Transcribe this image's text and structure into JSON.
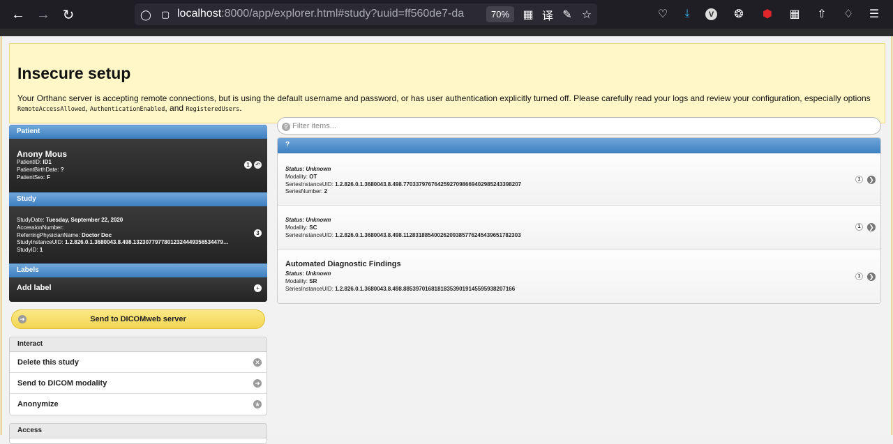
{
  "browser": {
    "url_host": "localhost",
    "url_rest": ":8000/app/explorer.html#study?uuid=ff560de7-da",
    "zoom": "70%"
  },
  "warning": {
    "title": "Insecure setup",
    "text": "Your Orthanc server is accepting remote connections, but is using the default username and password, or has user authentication explicitly turned off. Please carefully read your logs and review your configuration, especially options",
    "opt1": "RemoteAccessAllowed",
    "opt2": "AuthenticationEnabled",
    "and": ", and",
    "opt3": "RegisteredUsers"
  },
  "patient": {
    "header": "Patient",
    "name": "Anony Mous",
    "id_label": "PatientID:",
    "id": "ID1",
    "birth_label": "PatientBirthDate:",
    "birth": "?",
    "sex_label": "PatientSex:",
    "sex": "F",
    "count": "1"
  },
  "study": {
    "header": "Study",
    "date_label": "StudyDate:",
    "date": "Tuesday, September 22, 2020",
    "accession_label": "AccessionNumber:",
    "physician_label": "ReferringPhysicianName:",
    "physician": "Doctor Doc",
    "uid_label": "StudyInstanceUID:",
    "uid": "1.2.826.0.1.3680043.8.498.13230779778012324449356534479…",
    "id_label": "StudyID:",
    "id": "1",
    "count": "3"
  },
  "labels": {
    "header": "Labels",
    "add": "Add label"
  },
  "send_dicomweb": "Send to DICOMweb server",
  "interact": {
    "header": "Interact",
    "items": [
      "Delete this study",
      "Send to DICOM modality",
      "Anonymize"
    ]
  },
  "access": {
    "header": "Access"
  },
  "filter": {
    "placeholder": "Filter items..."
  },
  "series_panel": {
    "header": "?",
    "status_label": "Status:",
    "modality_label": "Modality:",
    "uid_label": "SeriesInstanceUID:",
    "number_label": "SeriesNumber:",
    "items": [
      {
        "title": "",
        "status": "Unknown",
        "modality": "OT",
        "uid": "1.2.826.0.1.3680043.8.498.77033797676425927098669402985243398207",
        "number": "2",
        "count": "1"
      },
      {
        "title": "",
        "status": "Unknown",
        "modality": "SC",
        "uid": "1.2.826.0.1.3680043.8.498.11283188540026209385776245439651782303",
        "number": "",
        "count": "1"
      },
      {
        "title": "Automated Diagnostic Findings",
        "status": "Unknown",
        "modality": "SR",
        "uid": "1.2.826.0.1.3680043.8.498.88539701681818353901914559593820716​6",
        "number": "",
        "count": "1"
      }
    ]
  }
}
